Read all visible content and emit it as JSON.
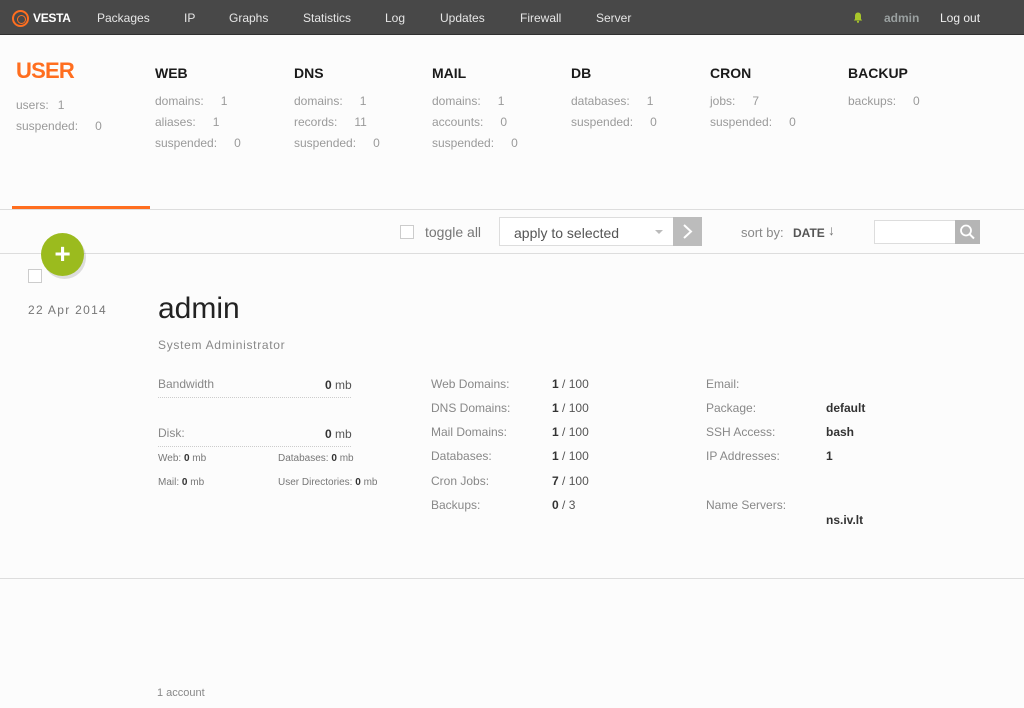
{
  "nav": {
    "logo_text": "VESTA",
    "items": [
      "Packages",
      "IP",
      "Graphs",
      "Statistics",
      "Log",
      "Updates",
      "Firewall",
      "Server"
    ],
    "user": "admin",
    "logout": "Log out"
  },
  "stats": {
    "user": {
      "title": "USER",
      "rows": [
        {
          "label": "users:",
          "value": "1"
        },
        {
          "label": "suspended:",
          "value": "0"
        }
      ]
    },
    "web": {
      "title": "WEB",
      "rows": [
        {
          "label": "domains:",
          "value": "1"
        },
        {
          "label": "aliases:",
          "value": "1"
        },
        {
          "label": "suspended:",
          "value": "0"
        }
      ]
    },
    "dns": {
      "title": "DNS",
      "rows": [
        {
          "label": "domains:",
          "value": "1"
        },
        {
          "label": "records:",
          "value": "11"
        },
        {
          "label": "suspended:",
          "value": "0"
        }
      ]
    },
    "mail": {
      "title": "MAIL",
      "rows": [
        {
          "label": "domains:",
          "value": "1"
        },
        {
          "label": "accounts:",
          "value": "0"
        },
        {
          "label": "suspended:",
          "value": "0"
        }
      ]
    },
    "db": {
      "title": "DB",
      "rows": [
        {
          "label": "databases:",
          "value": "1"
        },
        {
          "label": "suspended:",
          "value": "0"
        }
      ]
    },
    "cron": {
      "title": "CRON",
      "rows": [
        {
          "label": "jobs:",
          "value": "7"
        },
        {
          "label": "suspended:",
          "value": "0"
        }
      ]
    },
    "backup": {
      "title": "BACKUP",
      "rows": [
        {
          "label": "backups:",
          "value": "0"
        }
      ]
    }
  },
  "toolbar": {
    "toggle_all": "toggle all",
    "apply_select": "apply to selected",
    "sort_label": "sort by:",
    "sort_value": "DATE",
    "sort_arrow": "↓",
    "add_symbol": "+"
  },
  "account": {
    "date": "22 Apr 2014",
    "name": "admin",
    "role": "System Administrator",
    "bandwidth_label": "Bandwidth",
    "bandwidth_value": "0",
    "bandwidth_unit": "mb",
    "disk_label": "Disk:",
    "disk_value": "0",
    "disk_unit": "mb",
    "disk_breakdown": {
      "web_label": "Web:",
      "web_value": "0",
      "web_unit": "mb",
      "databases_label": "Databases:",
      "databases_value": "0",
      "databases_unit": "mb",
      "mail_label": "Mail:",
      "mail_value": "0",
      "mail_unit": "mb",
      "userdirs_label": "User Directories:",
      "userdirs_value": "0",
      "userdirs_unit": "mb"
    },
    "limits": [
      {
        "label": "Web Domains:",
        "used": "1",
        "sep": "/",
        "max": "100"
      },
      {
        "label": "DNS Domains:",
        "used": "1",
        "sep": "/",
        "max": "100"
      },
      {
        "label": "Mail Domains:",
        "used": "1",
        "sep": "/",
        "max": "100"
      },
      {
        "label": "Databases:",
        "used": "1",
        "sep": "/",
        "max": "100"
      },
      {
        "label": "Cron Jobs:",
        "used": "7",
        "sep": "/",
        "max": "100"
      },
      {
        "label": "Backups:",
        "used": "0",
        "sep": "/",
        "max": "3"
      }
    ],
    "info": {
      "email_label": "Email:",
      "email_value": "",
      "package_label": "Package:",
      "package_value": "default",
      "ssh_label": "SSH Access:",
      "ssh_value": "bash",
      "ip_label": "IP Addresses:",
      "ip_value": "1",
      "ns_label": "Name Servers:",
      "ns_value": "ns.iv.lt"
    }
  },
  "footer": {
    "count": "1 account"
  },
  "colors": {
    "accent": "#ff6e1f",
    "nav_bg": "#484848",
    "add_button": "#9bbb1e"
  }
}
